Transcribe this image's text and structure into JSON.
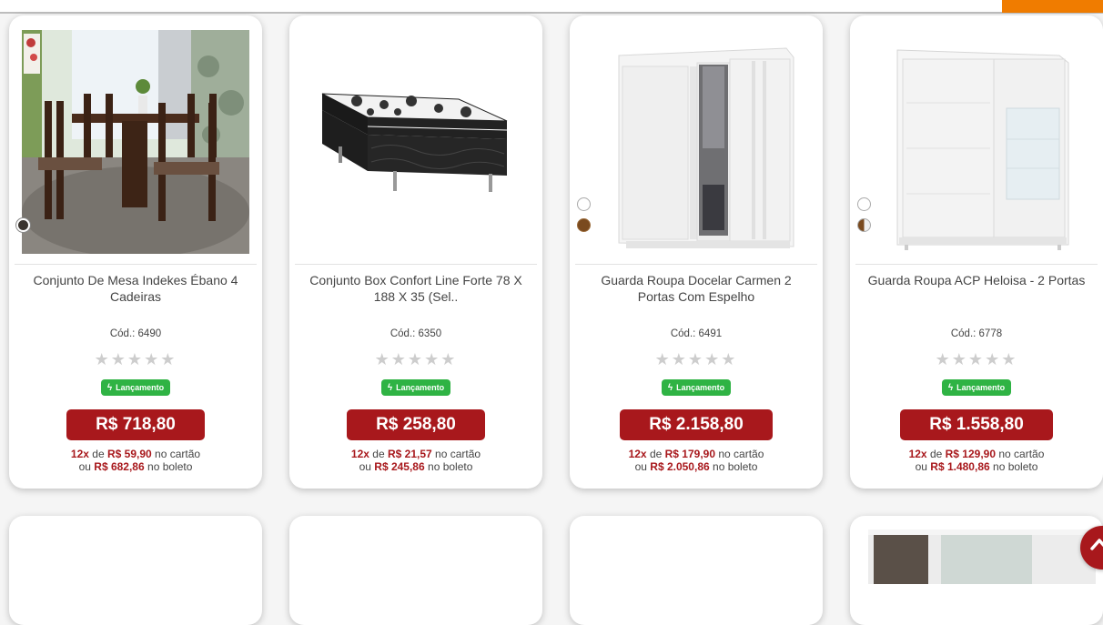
{
  "products": [
    {
      "title": "Conjunto De Mesa Indekes Ébano 4 Cadeiras",
      "code": "Cód.: 6490",
      "badge": "Lançamento",
      "price": "R$ 718,80",
      "installments": "12x",
      "installment_value": "R$ 59,90",
      "card_suffix": "no cartão",
      "boleto_prefix": "ou",
      "boleto_value": "R$ 682,86",
      "boleto_suffix": "no boleto"
    },
    {
      "title": "Conjunto Box Confort Line Forte 78 X 188 X 35 (Sel..",
      "code": "Cód.: 6350",
      "badge": "Lançamento",
      "price": "R$ 258,80",
      "installments": "12x",
      "installment_value": "R$ 21,57",
      "card_suffix": "no cartão",
      "boleto_prefix": "ou",
      "boleto_value": "R$ 245,86",
      "boleto_suffix": "no boleto"
    },
    {
      "title": "Guarda Roupa Docelar Carmen 2 Portas Com Espelho",
      "code": "Cód.: 6491",
      "badge": "Lançamento",
      "price": "R$ 2.158,80",
      "installments": "12x",
      "installment_value": "R$ 179,90",
      "card_suffix": "no cartão",
      "boleto_prefix": "ou",
      "boleto_value": "R$ 2.050,86",
      "boleto_suffix": "no boleto"
    },
    {
      "title": "Guarda Roupa ACP Heloisa - 2 Portas",
      "code": "Cód.: 6778",
      "badge": "Lançamento",
      "price": "R$ 1.558,80",
      "installments": "12x",
      "installment_value": "R$ 129,90",
      "card_suffix": "no cartão",
      "boleto_prefix": "ou",
      "boleto_value": "R$ 1.480,86",
      "boleto_suffix": "no boleto"
    }
  ],
  "stars": "★★★★★",
  "colors": {
    "accent": "#f07c00",
    "price": "#a8181c",
    "badge": "#2fb344"
  }
}
